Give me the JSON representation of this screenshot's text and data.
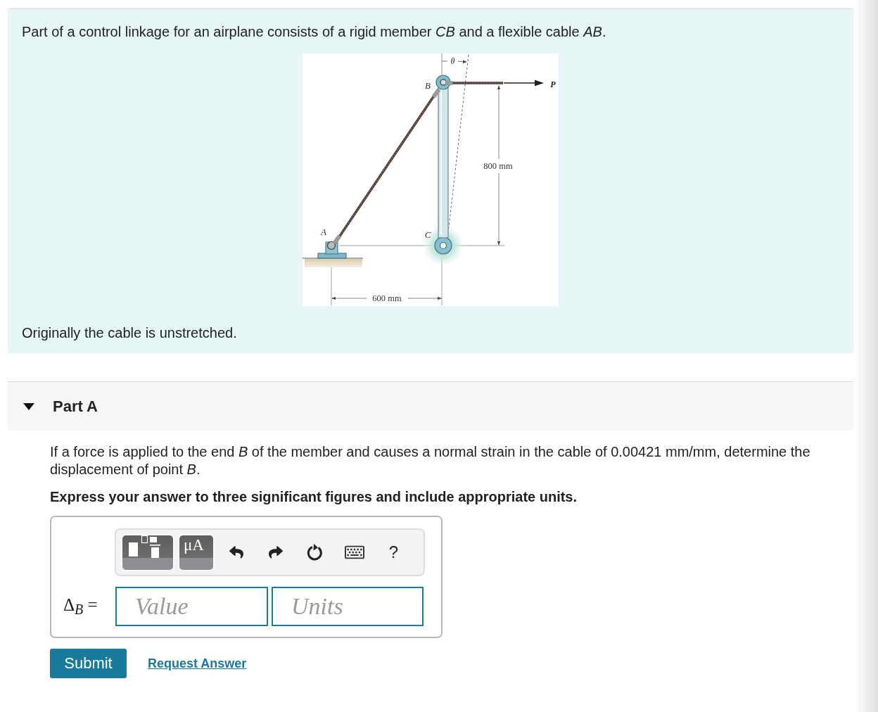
{
  "problem": {
    "intro": "Part of a control linkage for an airplane consists of a rigid member *CB* and a flexible cable *AB*.",
    "figure": {
      "angle": "θ",
      "point_b": "B",
      "force": "P",
      "height": "800 mm",
      "point_a": "A",
      "point_c": "C",
      "width": "600 mm"
    },
    "note": "Originally the cable is unstretched."
  },
  "part": {
    "title": "Part A",
    "expanded": true,
    "question": "If a force is applied to the end *B* of the member and causes a normal strain in the cable of 0.00421 mm/mm, determine the displacement of point *B*.",
    "instruction": "Express your answer to three significant figures and include appropriate units.",
    "toolbar": [
      {
        "kind": "templates"
      },
      {
        "kind": "symbols",
        "label": "μA"
      },
      {
        "kind": "undo"
      },
      {
        "kind": "redo"
      },
      {
        "kind": "reset"
      },
      {
        "kind": "keyboard"
      },
      {
        "kind": "help",
        "label": "?"
      }
    ],
    "answer": {
      "label": "Δ$_{B}$ =",
      "fields": [
        {
          "placeholder": "Value"
        },
        {
          "placeholder": "Units"
        }
      ]
    },
    "actions": [
      {
        "kind": "button",
        "label": "Submit"
      },
      {
        "kind": "link",
        "label": "Request Answer"
      }
    ]
  }
}
